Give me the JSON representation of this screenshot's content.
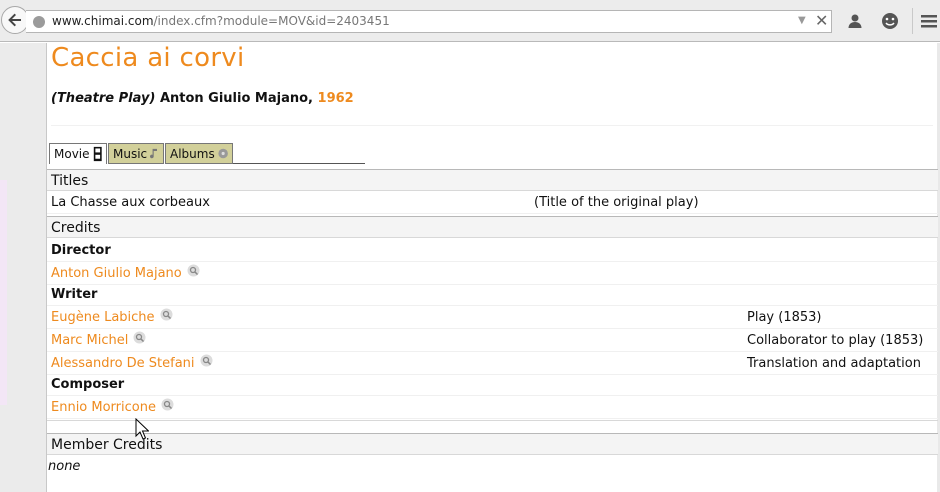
{
  "browser": {
    "url_domain": "www.chimai.com",
    "url_path": "/index.cfm?module=MOV&id=2403451"
  },
  "page": {
    "title": "Caccia ai corvi",
    "type_label": "(Theatre Play)",
    "author": "Anton Giulio Majano,",
    "year": "1962"
  },
  "tabs": [
    {
      "label": "Movie"
    },
    {
      "label": "Music"
    },
    {
      "label": "Albums"
    }
  ],
  "titles": {
    "heading": "Titles",
    "rows": [
      {
        "title": "La Chasse aux corbeaux",
        "note": "(Title of the original play)"
      }
    ]
  },
  "credits": {
    "heading": "Credits",
    "director_label": "Director",
    "director": "Anton Giulio Majano",
    "writer_label": "Writer",
    "writers": [
      {
        "name": "Eugène Labiche",
        "role": "Play (1853)"
      },
      {
        "name": "Marc Michel",
        "role": "Collaborator to play (1853)"
      },
      {
        "name": "Alessandro De Stefani",
        "role": "Translation and adaptation"
      }
    ],
    "composer_label": "Composer",
    "composer": "Ennio Morricone"
  },
  "member_credits": {
    "heading": "Member Credits",
    "value": "none"
  },
  "colors": {
    "accent": "#ee8a1e",
    "tab_inactive": "#d2d09a"
  }
}
